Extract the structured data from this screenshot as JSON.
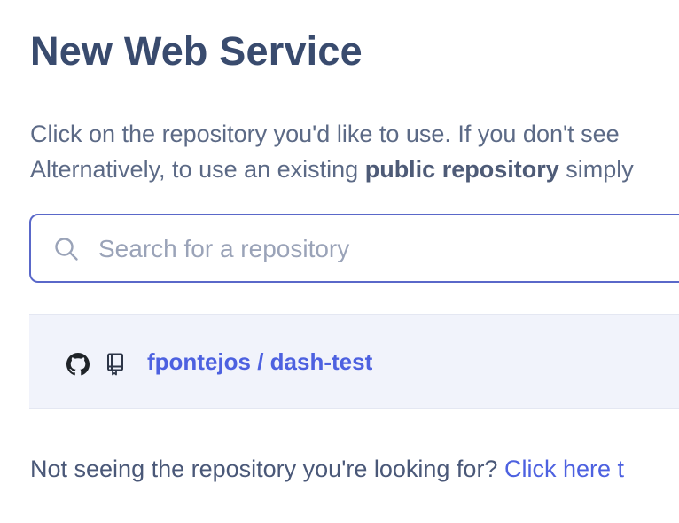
{
  "page": {
    "title": "New Web Service"
  },
  "intro": {
    "line1": "Click on the repository you'd like to use. If you don't see",
    "line2_prefix": "Alternatively, to use an existing ",
    "line2_bold": "public repository",
    "line2_suffix": " simply"
  },
  "search": {
    "placeholder": "Search for a repository",
    "value": "",
    "icon": "search-icon"
  },
  "repositories": [
    {
      "name": "fpontejos / dash-test",
      "provider_icon": "github-icon",
      "type_icon": "book-icon"
    }
  ],
  "footer": {
    "text": "Not seeing the repository you're looking for? ",
    "link_label": "Click here t"
  },
  "colors": {
    "heading": "#394b6e",
    "body_text": "#5c6a86",
    "accent": "#4d61e0",
    "input_border": "#5a68c9",
    "row_background": "#f1f3fb",
    "placeholder": "#9aa3b8"
  }
}
